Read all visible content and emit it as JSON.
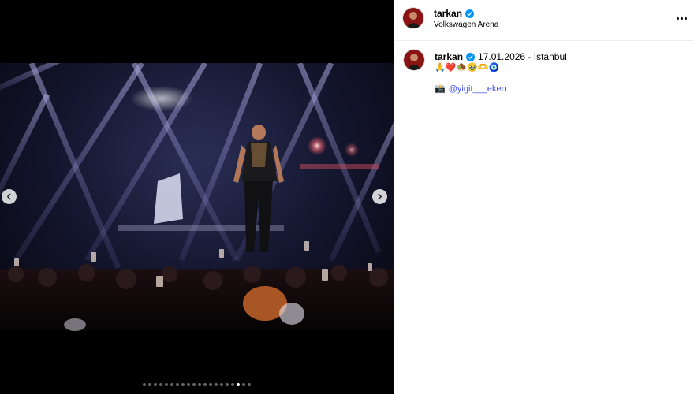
{
  "post": {
    "username": "tarkan",
    "location": "Volkswagen Arena",
    "caption_username": "tarkan",
    "caption_text": "17.01.2026 - İstanbul",
    "caption_emojis": "🙏❤️🧆🥹🫶🧿",
    "credit_prefix": "📸:",
    "credit_mention": "@yigit___eken"
  },
  "carousel": {
    "total_slides": 20,
    "active_index": 17
  },
  "colors": {
    "verified": "#0095f6",
    "mention": "#4150f7",
    "avatar": "#8a1414"
  },
  "icons": [
    "verified-icon",
    "more-options-icon",
    "chevron-left-icon",
    "chevron-right-icon"
  ]
}
